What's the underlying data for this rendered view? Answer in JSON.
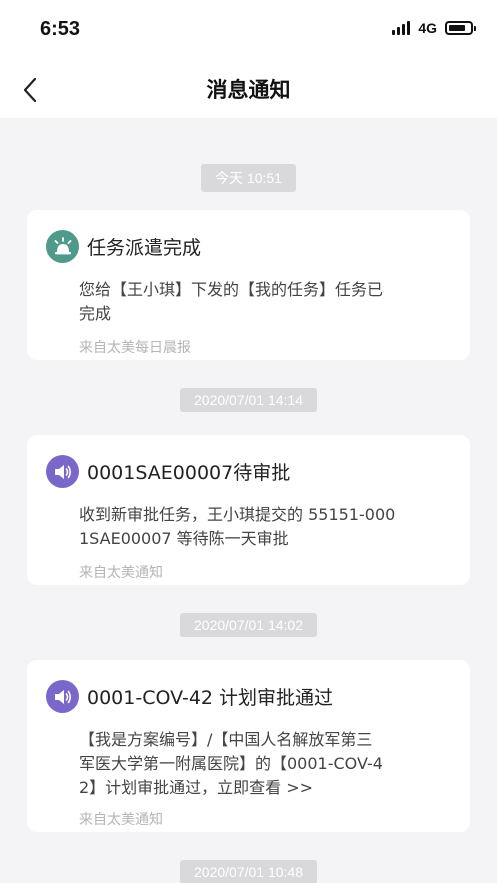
{
  "status_bar": {
    "time": "6:53",
    "network": "4G",
    "battery_level": 0.8
  },
  "nav": {
    "title": "消息通知"
  },
  "messages": [
    {
      "timestamp": "今天 10:51",
      "icon": "alarm-icon",
      "icon_color": "#4f9a8a",
      "title": "任务派遣完成",
      "body_lines": [
        "您给【王小琪】下发的【我的任务】任务已",
        "完成"
      ],
      "source": "来自太美每日晨报"
    },
    {
      "timestamp": "2020/07/01 14:14",
      "icon": "speaker-icon",
      "icon_color": "#7b67c9",
      "title": "0001SAE00007待审批",
      "body_lines": [
        "收到新审批任务，王小琪提交的 55151-000",
        "1SAE00007 等待陈一天审批"
      ],
      "source": "来自太美通知"
    },
    {
      "timestamp": "2020/07/01 14:02",
      "icon": "speaker-icon",
      "icon_color": "#7b67c9",
      "title": "0001-COV-42 计划审批通过",
      "body_lines": [
        "【我是方案编号】/【中国人名解放军第三",
        "军医大学第一附属医院】的【0001-COV-4",
        "2】计划审批通过，立即查看 >>"
      ],
      "source": "来自太美通知"
    },
    {
      "timestamp": "2020/07/01 10:48"
    }
  ]
}
